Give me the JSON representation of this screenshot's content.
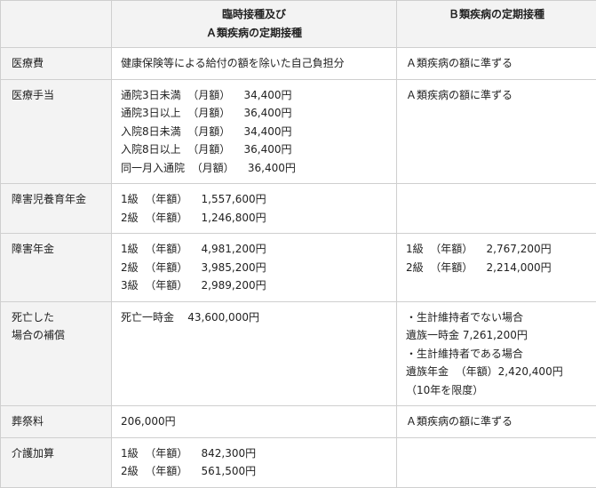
{
  "headers": {
    "col_a_line1": "臨時接種及び",
    "col_a_line2": "Ａ類疾病の定期接種",
    "col_b": "Ｂ類疾病の定期接種"
  },
  "rows": [
    {
      "item": [
        "医療費"
      ],
      "a": [
        "健康保険等による給付の額を除いた自己負担分"
      ],
      "b": [
        "Ａ類疾病の額に準ずる"
      ]
    },
    {
      "item": [
        "医療手当"
      ],
      "a": [
        "通院3日未満  （月額）    34,400円",
        "通院3日以上  （月額）    36,400円",
        "入院8日未満  （月額）    34,400円",
        "入院8日以上  （月額）    36,400円",
        "同一月入通院  （月額）    36,400円"
      ],
      "b": [
        "Ａ類疾病の額に準ずる"
      ]
    },
    {
      "item": [
        "障害児養育年金"
      ],
      "a": [
        "1級  （年額）    1,557,600円",
        "2級  （年額）    1,246,800円"
      ],
      "b": []
    },
    {
      "item": [
        "障害年金"
      ],
      "a": [
        "1級  （年額）    4,981,200円",
        "2級  （年額）    3,985,200円",
        "3級  （年額）    2,989,200円"
      ],
      "b": [
        "1級  （年額）    2,767,200円",
        "2級  （年額）    2,214,000円"
      ]
    },
    {
      "item": [
        "死亡した",
        "場合の補償"
      ],
      "a": [
        "死亡一時金    43,600,000円"
      ],
      "b": [
        "・生計維持者でない場合",
        "遺族一時金 7,261,200円",
        "・生計維持者である場合",
        "遺族年金  （年額）2,420,400円",
        "（10年を限度）"
      ]
    },
    {
      "item": [
        "葬祭料"
      ],
      "a": [
        "206,000円"
      ],
      "b": [
        "Ａ類疾病の額に準ずる"
      ]
    },
    {
      "item": [
        "介護加算"
      ],
      "a": [
        "1級  （年額）    842,300円",
        "2級  （年額）    561,500円"
      ],
      "b": []
    }
  ]
}
